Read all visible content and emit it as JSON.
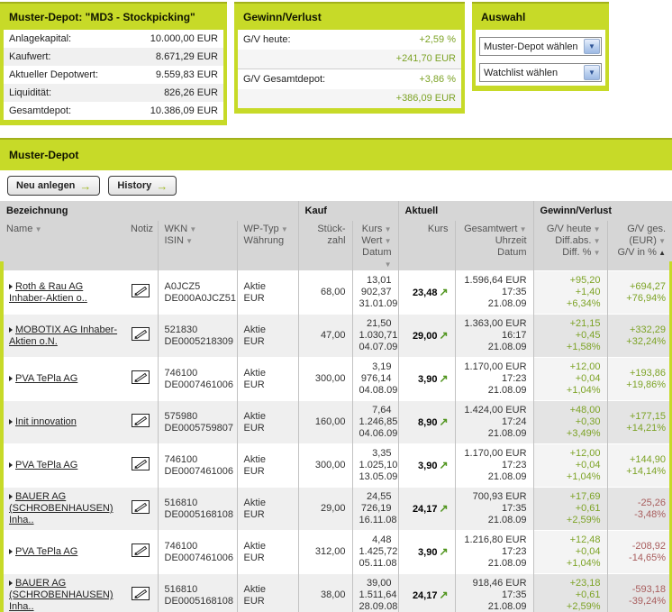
{
  "colors": {
    "lime": "#c7da28",
    "lime_dark": "#a2b11c",
    "positive_green": "#7da326",
    "negative_red": "#a85c5c",
    "header_gray": "#d6d6d6",
    "row_alt_gray": "#efefef"
  },
  "summary": {
    "title": "Muster-Depot: \"MD3 - Stockpicking\"",
    "rows": [
      {
        "label": "Anlagekapital:",
        "value": "10.000,00 EUR"
      },
      {
        "label": "Kaufwert:",
        "value": "8.671,29 EUR"
      },
      {
        "label": "Aktueller Depotwert:",
        "value": "9.559,83 EUR"
      },
      {
        "label": "Liquidität:",
        "value": "826,26 EUR"
      },
      {
        "label": "Gesamtdepot:",
        "value": "10.386,09 EUR"
      }
    ]
  },
  "gv": {
    "title": "Gewinn/Verlust",
    "rows": [
      {
        "label": "G/V heute:",
        "pct": "+2,59 %",
        "eur": "+241,70 EUR"
      },
      {
        "label": "G/V Gesamtdepot:",
        "pct": "+3,86 %",
        "eur": "+386,09 EUR"
      }
    ]
  },
  "auswahl": {
    "title": "Auswahl",
    "selects": [
      "Muster-Depot wählen",
      "Watchlist wählen"
    ]
  },
  "depot": {
    "title": "Muster-Depot",
    "buttons": [
      {
        "label": "Neu anlegen",
        "arrow": "→"
      },
      {
        "label": "History",
        "arrow": "→"
      }
    ]
  },
  "table": {
    "groups": [
      {
        "label": "Bezeichnung",
        "span": 4,
        "bl": false
      },
      {
        "label": "Kauf",
        "span": 2,
        "bl": true
      },
      {
        "label": "Aktuell",
        "span": 2,
        "bl": true
      },
      {
        "label": "Gewinn/Verlust",
        "span": 2,
        "bl": true
      }
    ],
    "columns": [
      {
        "key": "name",
        "align": "al",
        "bl": false,
        "lines": [
          {
            "t": "Name",
            "a": "d"
          }
        ]
      },
      {
        "key": "notiz",
        "align": "ar",
        "bl": false,
        "lines": [
          {
            "t": "Notiz",
            "a": null
          }
        ]
      },
      {
        "key": "wkn",
        "align": "al",
        "bl": true,
        "lines": [
          {
            "t": "WKN",
            "a": "d"
          },
          {
            "t": "ISIN",
            "a": "d"
          }
        ]
      },
      {
        "key": "wptyp",
        "align": "al",
        "bl": true,
        "lines": [
          {
            "t": "WP-Typ",
            "a": "d"
          },
          {
            "t": "Währung",
            "a": null
          }
        ]
      },
      {
        "key": "stueck",
        "align": "ar",
        "bl": true,
        "lines": [
          {
            "t": "Stück-",
            "a": null
          },
          {
            "t": "zahl",
            "a": null
          }
        ]
      },
      {
        "key": "kauf",
        "align": "ar",
        "bl": true,
        "lines": [
          {
            "t": "Kurs",
            "a": "d"
          },
          {
            "t": "Wert",
            "a": "d"
          },
          {
            "t": "Datum",
            "a": "d"
          }
        ]
      },
      {
        "key": "kurs",
        "align": "ar",
        "bl": true,
        "bold": true,
        "lines": [
          {
            "t": "Kurs",
            "a": null
          }
        ]
      },
      {
        "key": "gesamt",
        "align": "ar",
        "bl": true,
        "lines": [
          {
            "t": "Gesamtwert",
            "a": "d"
          },
          {
            "t": "Uhrzeit",
            "a": null
          },
          {
            "t": "Datum",
            "a": null
          }
        ]
      },
      {
        "key": "gvheute",
        "align": "ar",
        "bl": true,
        "tint": true,
        "lines": [
          {
            "t": "G/V heute",
            "a": "d"
          },
          {
            "t": "Diff.abs.",
            "a": "d"
          },
          {
            "t": "Diff. %",
            "a": "d"
          }
        ]
      },
      {
        "key": "gvges",
        "align": "ar",
        "bl": true,
        "tint": true,
        "lines": [
          {
            "t": "G/V ges.",
            "a": null
          },
          {
            "t": "(EUR)",
            "a": "d"
          },
          {
            "t": "G/V in %",
            "a": "u"
          }
        ]
      }
    ],
    "rows": [
      {
        "name": "Roth & Rau AG Inhaber-Aktien o..",
        "wkn": "A0JCZ5",
        "isin": "DE000A0JCZ51",
        "typ": "Aktie",
        "cur": "EUR",
        "qty": "68,00",
        "k_kurs": "13,01",
        "k_wert": "902,37",
        "k_datum": "31.01.09",
        "kurs": "23,48",
        "gesamt": "1.596,64 EUR",
        "uhrzeit": "17:35",
        "datum": "21.08.09",
        "h1": "+95,20",
        "h2": "+1,40",
        "h3": "+6,34%",
        "t1": "+694,27",
        "t2": "+76,94%",
        "neg": false
      },
      {
        "name": "MOBOTIX AG Inhaber-Aktien o.N.",
        "wkn": "521830",
        "isin": "DE0005218309",
        "typ": "Aktie",
        "cur": "EUR",
        "qty": "47,00",
        "k_kurs": "21,50",
        "k_wert": "1.030,71",
        "k_datum": "04.07.09",
        "kurs": "29,00",
        "gesamt": "1.363,00 EUR",
        "uhrzeit": "16:17",
        "datum": "21.08.09",
        "h1": "+21,15",
        "h2": "+0,45",
        "h3": "+1,58%",
        "t1": "+332,29",
        "t2": "+32,24%",
        "neg": false
      },
      {
        "name": "PVA TePla AG",
        "wkn": "746100",
        "isin": "DE0007461006",
        "typ": "Aktie",
        "cur": "EUR",
        "qty": "300,00",
        "k_kurs": "3,19",
        "k_wert": "976,14",
        "k_datum": "04.08.09",
        "kurs": "3,90",
        "gesamt": "1.170,00 EUR",
        "uhrzeit": "17:23",
        "datum": "21.08.09",
        "h1": "+12,00",
        "h2": "+0,04",
        "h3": "+1,04%",
        "t1": "+193,86",
        "t2": "+19,86%",
        "neg": false
      },
      {
        "name": "Init innovation",
        "wkn": "575980",
        "isin": "DE0005759807",
        "typ": "Aktie",
        "cur": "EUR",
        "qty": "160,00",
        "k_kurs": "7,64",
        "k_wert": "1.246,85",
        "k_datum": "04.06.09",
        "kurs": "8,90",
        "gesamt": "1.424,00 EUR",
        "uhrzeit": "17:24",
        "datum": "21.08.09",
        "h1": "+48,00",
        "h2": "+0,30",
        "h3": "+3,49%",
        "t1": "+177,15",
        "t2": "+14,21%",
        "neg": false
      },
      {
        "name": "PVA TePla AG",
        "wkn": "746100",
        "isin": "DE0007461006",
        "typ": "Aktie",
        "cur": "EUR",
        "qty": "300,00",
        "k_kurs": "3,35",
        "k_wert": "1.025,10",
        "k_datum": "13.05.09",
        "kurs": "3,90",
        "gesamt": "1.170,00 EUR",
        "uhrzeit": "17:23",
        "datum": "21.08.09",
        "h1": "+12,00",
        "h2": "+0,04",
        "h3": "+1,04%",
        "t1": "+144,90",
        "t2": "+14,14%",
        "neg": false
      },
      {
        "name": "BAUER AG (SCHROBENHAUSEN) Inha..",
        "wkn": "516810",
        "isin": "DE0005168108",
        "typ": "Aktie",
        "cur": "EUR",
        "qty": "29,00",
        "k_kurs": "24,55",
        "k_wert": "726,19",
        "k_datum": "16.11.08",
        "kurs": "24,17",
        "gesamt": "700,93 EUR",
        "uhrzeit": "17:35",
        "datum": "21.08.09",
        "h1": "+17,69",
        "h2": "+0,61",
        "h3": "+2,59%",
        "t1": "-25,26",
        "t2": "-3,48%",
        "neg": true
      },
      {
        "name": "PVA TePla AG",
        "wkn": "746100",
        "isin": "DE0007461006",
        "typ": "Aktie",
        "cur": "EUR",
        "qty": "312,00",
        "k_kurs": "4,48",
        "k_wert": "1.425,72",
        "k_datum": "05.11.08",
        "kurs": "3,90",
        "gesamt": "1.216,80 EUR",
        "uhrzeit": "17:23",
        "datum": "21.08.09",
        "h1": "+12,48",
        "h2": "+0,04",
        "h3": "+1,04%",
        "t1": "-208,92",
        "t2": "-14,65%",
        "neg": true
      },
      {
        "name": "BAUER AG (SCHROBENHAUSEN) Inha..",
        "wkn": "516810",
        "isin": "DE0005168108",
        "typ": "Aktie",
        "cur": "EUR",
        "qty": "38,00",
        "k_kurs": "39,00",
        "k_wert": "1.511,64",
        "k_datum": "28.09.08",
        "kurs": "24,17",
        "gesamt": "918,46 EUR",
        "uhrzeit": "17:35",
        "datum": "21.08.09",
        "h1": "+23,18",
        "h2": "+0,61",
        "h3": "+2,59%",
        "t1": "-593,18",
        "t2": "-39,24%",
        "neg": true
      }
    ]
  },
  "icons": {
    "trend_up": "↗",
    "select_chevron": "▼",
    "sort_desc": "▼",
    "sort_asc": "▲"
  }
}
